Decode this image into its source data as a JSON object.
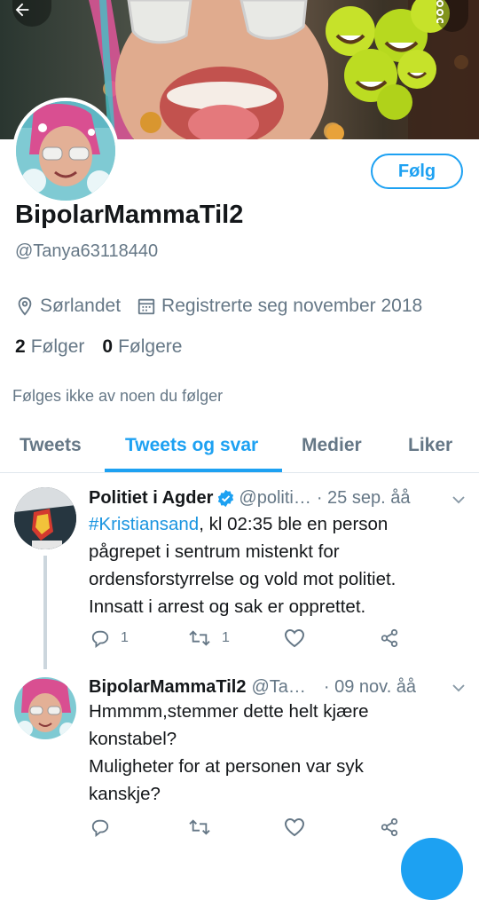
{
  "header": {
    "back_icon": "arrow-left-icon",
    "menu_icon": "more-vertical-icon",
    "follow_label": "Følg"
  },
  "profile": {
    "display_name": "BipolarMammaTil2",
    "handle": "@Tanya63118440",
    "location": "Sørlandet",
    "joined": "Registrerte seg november 2018",
    "following_count": "2",
    "following_label": "Følger",
    "followers_count": "0",
    "followers_label": "Følgere",
    "followed_by_text": "Følges ikke av noen du følger"
  },
  "tabs": [
    {
      "label": "Tweets",
      "active": false
    },
    {
      "label": "Tweets og svar",
      "active": true
    },
    {
      "label": "Medier",
      "active": false
    },
    {
      "label": "Liker",
      "active": false
    }
  ],
  "tweets": [
    {
      "author": "Politiet i Agder",
      "verified": true,
      "handle": "@politi…",
      "date": "· 25 sep. åå",
      "hashtag": "#Kristiansand",
      "text_lines": [
        ", kl 02:35 ble en person",
        "pågrepet i sentrum mistenkt for",
        "ordensforstyrrelse og vold mot politiet.",
        "Innsatt i arrest og sak er opprettet."
      ],
      "reply_count": "1",
      "retweet_count": "1",
      "like_count": ""
    },
    {
      "author": "BipolarMammaTil2",
      "verified": false,
      "handle": "@Ta…",
      "date": "· 09 nov. åå",
      "text_lines": [
        "Hmmmm,stemmer dette helt kjære",
        "konstabel?",
        "Muligheter for at personen var syk",
        "kanskje?"
      ],
      "reply_count": "",
      "retweet_count": "",
      "like_count": ""
    }
  ],
  "colors": {
    "accent": "#1da1f2",
    "hashtag": "#1b95e0",
    "secondary_text": "#657786",
    "primary_text": "#14171a",
    "divider": "#e1e8ed"
  }
}
